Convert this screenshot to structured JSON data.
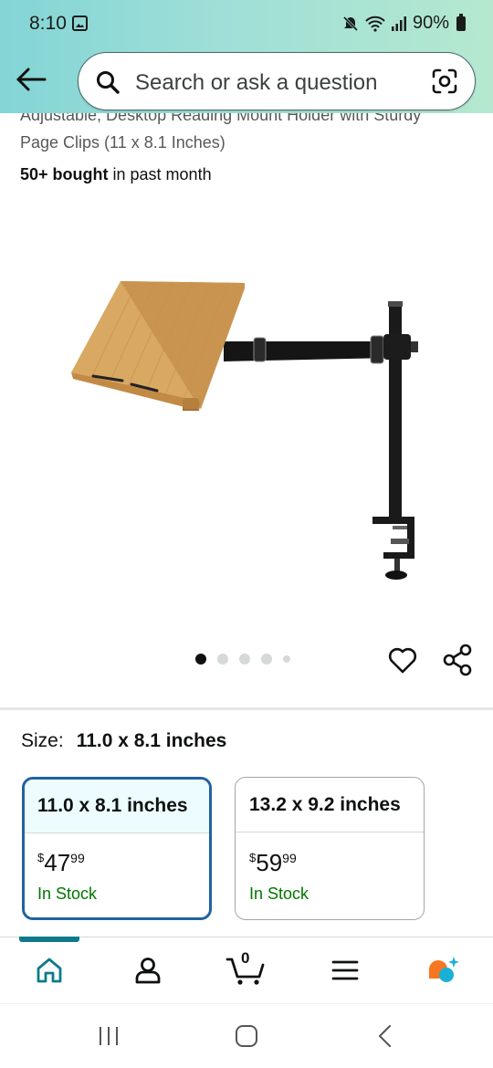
{
  "status_bar": {
    "time": "8:10",
    "battery": "90%"
  },
  "search": {
    "placeholder": "Search or ask a question"
  },
  "product": {
    "title_partial_line": "Adjustable, Desktop Reading Mount Holder with Sturdy",
    "title_line2": "Page Clips (11 x 8.1 Inches)",
    "bought_strong": "50+ bought",
    "bought_rest": " in past month",
    "image_count": 5,
    "active_image_index": 0
  },
  "size": {
    "label": "Size:",
    "selected_value": "11.0 x 8.1 inches",
    "options": [
      {
        "name": "11.0 x 8.1 inches",
        "currency": "$",
        "dollars": "47",
        "cents": "99",
        "stock": "In Stock",
        "selected": true
      },
      {
        "name": "13.2 x 9.2 inches",
        "currency": "$",
        "dollars": "59",
        "cents": "99",
        "stock": "In Stock",
        "selected": false
      }
    ]
  },
  "bottom_nav": {
    "cart_count": "0",
    "items": [
      "home-icon",
      "account-icon",
      "cart-icon",
      "menu-icon",
      "rufus-icon"
    ]
  },
  "colors": {
    "header_gradient_start": "#83d5d6",
    "header_gradient_end": "#b5e8cf",
    "selected_border": "#2162a1",
    "in_stock": "#007600",
    "nav_accent": "#0e7a8c",
    "rufus_orange": "#f7761f",
    "rufus_blue": "#1ab0d6"
  }
}
